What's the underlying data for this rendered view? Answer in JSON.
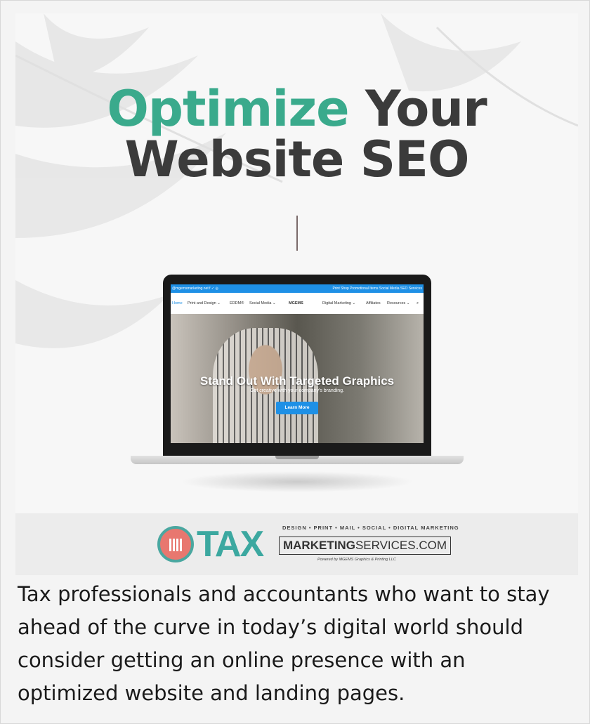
{
  "headline": {
    "accent": "Optimize",
    "rest_line1": "Your",
    "line2": "Website SEO"
  },
  "laptop_site": {
    "topbar_left": "@mgemsmarketing.net  f  ✓  ◎",
    "topbar_right": "Print Shop   Promotional Items   Social Media   SEO Services",
    "nav": {
      "home": "Home",
      "print_design": "Print and Design ⌄",
      "eddm": "EDDM®",
      "social_media": "Social Media ⌄",
      "logo": "MGEMS",
      "digital_marketing": "Digital Marketing ⌄",
      "affiliates": "Affiliates",
      "resources": "Resources ⌄"
    },
    "slide_title": "Stand Out With Targeted Graphics",
    "slide_subtitle": "Get creative with your company's branding.",
    "cta_label": "Learn More",
    "brand_color": "#1e90e6"
  },
  "brand": {
    "tax": "TAX",
    "tagline": "DESIGN • PRINT • MAIL • SOCIAL • DIGITAL MARKETING",
    "domain_bold": "MARKETING",
    "domain_rest": "SERVICES.COM",
    "powered": "Powered by MGEMS Graphics & Printing LLC",
    "accent_color": "#3ca8a0"
  },
  "caption": "Tax professionals and accountants who want to stay ahead of the curve in today’s digital world should consider getting an online presence with an optimized website and landing pages."
}
